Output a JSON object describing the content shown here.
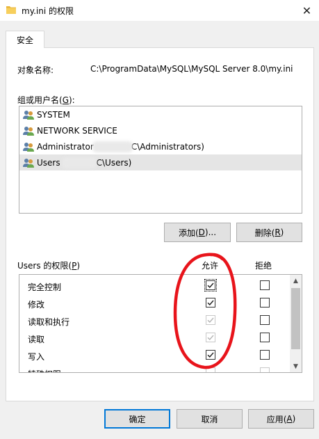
{
  "window": {
    "title": "my.ini 的权限",
    "close_glyph": "✕"
  },
  "tab": {
    "label": "安全"
  },
  "object": {
    "label": "对象名称:",
    "path": "C:\\ProgramData\\MySQL\\MySQL Server 8.0\\my.ini"
  },
  "groups": {
    "label_prefix": "组或用户名(",
    "label_key": "G",
    "label_suffix": "):",
    "items": [
      {
        "name": "SYSTEM",
        "suffix": ""
      },
      {
        "name": "NETWORK SERVICE",
        "suffix": ""
      },
      {
        "name": "Administrator",
        "suffix": "C\\Administrators)"
      },
      {
        "name": "Users",
        "suffix": "C\\Users)"
      }
    ]
  },
  "buttons": {
    "add_prefix": "添加(",
    "add_key": "D",
    "add_suffix": ")...",
    "remove_prefix": "删除(",
    "remove_key": "R",
    "remove_suffix": ")",
    "ok": "确定",
    "cancel": "取消",
    "apply_prefix": "应用(",
    "apply_key": "A",
    "apply_suffix": ")"
  },
  "permissions": {
    "title_prefix": "Users 的权限(",
    "title_key": "P",
    "title_suffix": ")",
    "allow_header": "允许",
    "deny_header": "拒绝",
    "rows": [
      {
        "name": "完全控制",
        "allow": true,
        "allow_dim": false,
        "deny": false,
        "deny_dim": false
      },
      {
        "name": "修改",
        "allow": true,
        "allow_dim": false,
        "deny": false,
        "deny_dim": false
      },
      {
        "name": "读取和执行",
        "allow": true,
        "allow_dim": true,
        "deny": false,
        "deny_dim": false
      },
      {
        "name": "读取",
        "allow": true,
        "allow_dim": true,
        "deny": false,
        "deny_dim": false
      },
      {
        "name": "写入",
        "allow": true,
        "allow_dim": false,
        "deny": false,
        "deny_dim": false
      },
      {
        "name": "特殊权限",
        "allow": false,
        "allow_dim": true,
        "deny": false,
        "deny_dim": true
      }
    ]
  },
  "icons": {
    "title": "folder-icon",
    "user": "users-icon",
    "scroll_up": "chevron-up-icon",
    "scroll_down": "chevron-down-icon"
  },
  "colors": {
    "accent": "#0078d7",
    "annotation": "#e8141b",
    "check_enabled": "#1a1a1a",
    "check_disabled": "#b4b4b4"
  }
}
